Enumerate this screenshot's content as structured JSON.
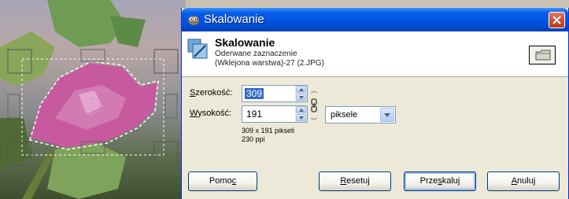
{
  "dialog": {
    "title": "Skalowanie",
    "header_title": "Skalowanie",
    "header_sub1": "Oderwane zaznaczenie",
    "header_sub2": "(Wklejona warstwa)-27 (2.JPG)"
  },
  "form": {
    "width_label_u": "S",
    "width_label_rest": "zerokość:",
    "width_value": "309",
    "height_label_u": "W",
    "height_label_rest": "ysokość:",
    "height_value": "191",
    "unit_value": "piksele",
    "size_info": "309 x 191 pikseli",
    "resolution_info": "230 ppi"
  },
  "buttons": {
    "help_pre": "Pomo",
    "help_u": "c",
    "reset_u": "R",
    "reset_rest": "esetuj",
    "scale_pre": "Prze",
    "scale_u": "s",
    "scale_rest": "kaluj",
    "cancel_u": "A",
    "cancel_rest": "nuluj"
  },
  "icons": {
    "app": "gimp-wilber-icon",
    "header": "scale-layer-icon",
    "image_preview": "image-preview-icon",
    "chain": "chain-link-icon",
    "close": "close-icon"
  },
  "colors": {
    "titlebar": "#0054e3",
    "close_button": "#d1502f",
    "selection_highlight": "#316ac5"
  }
}
